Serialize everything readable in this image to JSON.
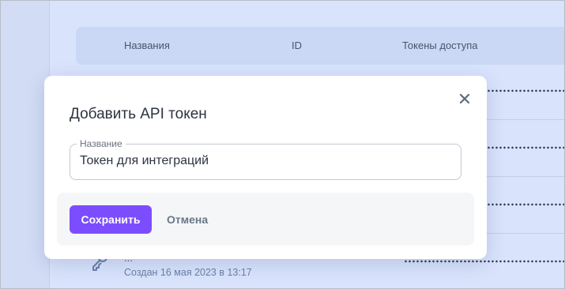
{
  "table": {
    "columns": [
      "Названия",
      "ID",
      "Токены доступа"
    ]
  },
  "rows": [
    {
      "title": "...",
      "created": "Создан 16 мая 2023 в 13:17",
      "icon": "key-icon"
    }
  ],
  "modal": {
    "title": "Добавить API токен",
    "field_label": "Название",
    "field_value": "Токен для интеграций",
    "save_label": "Сохранить",
    "cancel_label": "Отмена",
    "close_icon": "close-icon"
  },
  "colors": {
    "accent": "#7c4dff",
    "backdrop": "#d9e3fc",
    "text": "#2d3340"
  }
}
